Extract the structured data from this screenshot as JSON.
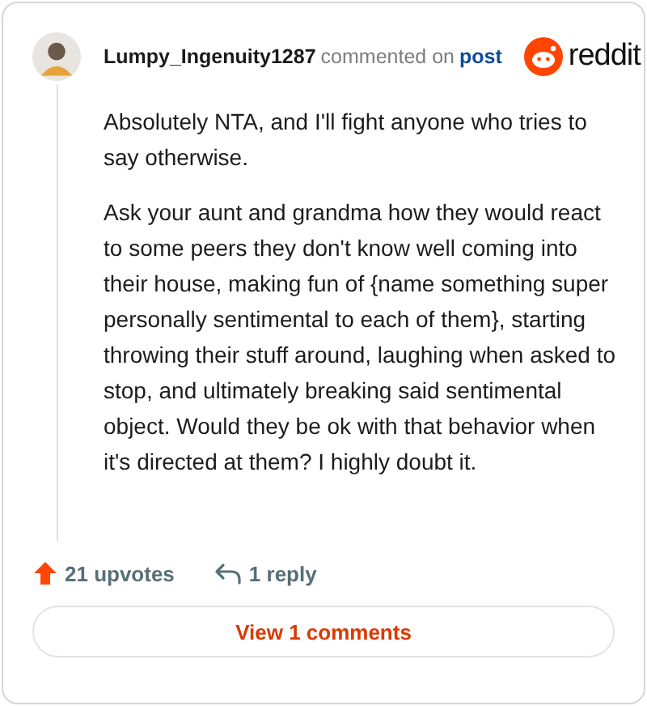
{
  "comment": {
    "author": "Lumpy_Ingenuity1287",
    "action": "commented on",
    "link": "post",
    "brand": "reddit",
    "paragraphs": [
      "Absolutely NTA, and I'll fight anyone who tries to say otherwise.",
      "Ask your aunt and grandma how they would react to some peers they don't know well coming into their house, making fun of {name something super personally sentimental to each of them}, starting throwing their stuff around, laughing when asked to stop, and ultimately breaking said sentimental object. Would they be ok with that behavior when it's directed at them? I highly doubt it."
    ],
    "upvotes": "21 upvotes",
    "replies": "1 reply"
  },
  "button": {
    "label": "View 1 comments"
  }
}
